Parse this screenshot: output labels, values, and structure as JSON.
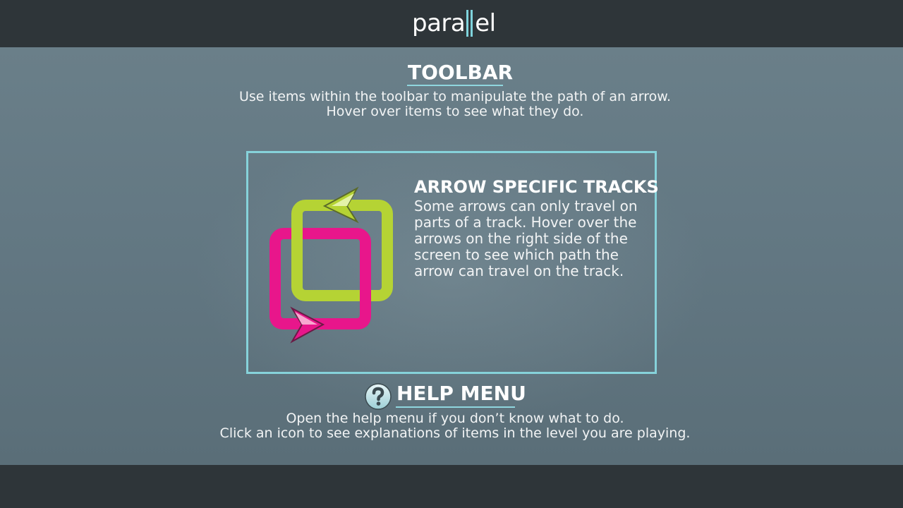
{
  "header": {
    "logo_left": "para",
    "logo_right": "el"
  },
  "toolbar_section": {
    "title": "TOOLBAR",
    "lines": [
      "Use items within the toolbar to manipulate the path of an arrow.",
      "Hover over items to see what they do."
    ]
  },
  "arrow_tracks_panel": {
    "title": "ARROW SPECIFIC TRACKS",
    "lines": [
      "Some arrows can only travel on",
      "parts of a track. Hover over the",
      "arrows on the right side of the",
      "screen to see which path the",
      "arrow can travel on the track."
    ],
    "icon": "dual-track-arrows-icon"
  },
  "help_section": {
    "title": "HELP MENU",
    "icon": "question-mark-icon",
    "lines": [
      "Open the help menu if you don’t know what to do.",
      "Click an icon to see explanations of items in the level you are playing."
    ]
  },
  "colors": {
    "accent": "#86d2da",
    "bar": "#2e3539",
    "green_track": "#b5d334",
    "pink_track": "#e8168b"
  }
}
